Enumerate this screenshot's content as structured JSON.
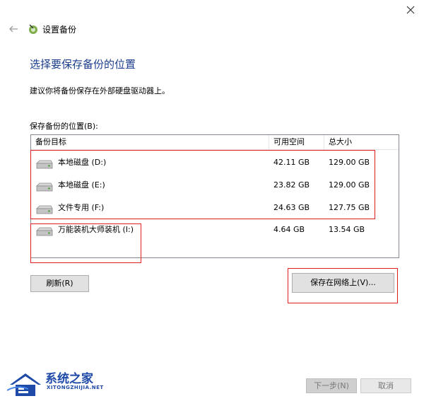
{
  "window": {
    "title": "设置备份"
  },
  "main": {
    "heading": "选择要保存备份的位置",
    "description": "建议你将备份保存在外部硬盘驱动器上。",
    "location_label": "保存备份的位置(B):"
  },
  "table": {
    "columns": [
      "备份目标",
      "可用空间",
      "总大小"
    ],
    "rows": [
      {
        "name": "本地磁盘 (D:)",
        "free": "42.11 GB",
        "total": "129.00 GB",
        "icon": "drive-icon"
      },
      {
        "name": "本地磁盘 (E:)",
        "free": "23.82 GB",
        "total": "129.00 GB",
        "icon": "drive-icon"
      },
      {
        "name": "文件专用 (F:)",
        "free": "24.63 GB",
        "total": "127.75 GB",
        "icon": "drive-icon"
      },
      {
        "name": "万能装机大师装机 (I:)",
        "free": "4.64 GB",
        "total": "13.54 GB",
        "icon": "drive-icon"
      }
    ]
  },
  "buttons": {
    "refresh": "刷新(R)",
    "save_network": "保存在网络上(V)...",
    "next": "下一步(N)",
    "cancel": "取消"
  },
  "watermark": {
    "name": "系统之家",
    "url": "XITONGZHIJIA.NET"
  },
  "colors": {
    "heading": "#1b3d8c",
    "highlight_box": "#e02020",
    "watermark": "#1f4aa8"
  }
}
